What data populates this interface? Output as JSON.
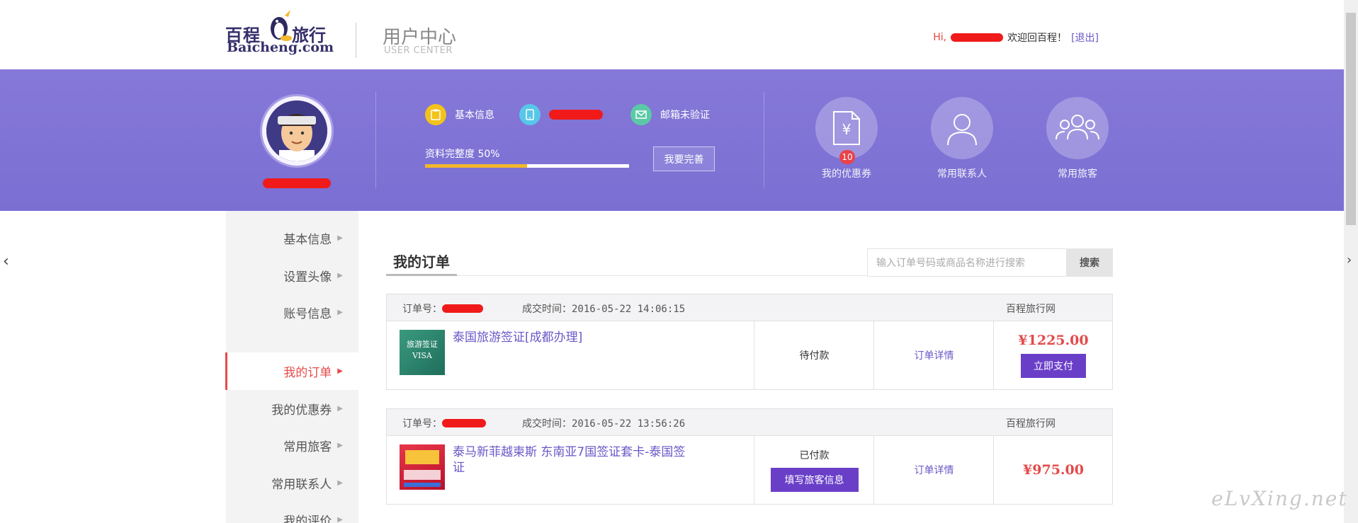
{
  "header": {
    "logo_cn_left": "百程",
    "logo_cn_right": "旅行",
    "logo_en": "Baicheng.com",
    "center_title": "用户中心",
    "center_subtitle": "USER CENTER",
    "greeting_hi": "Hi,",
    "greeting_welcome": "欢迎回百程！",
    "logout": "[退出]"
  },
  "profile": {
    "basic_info": "基本信息",
    "email_status": "邮箱未验证",
    "completion_label": "资料完整度 50%",
    "completion_value": 0.5,
    "complete_button": "我要完善"
  },
  "quick_links": [
    {
      "label": "我的优惠券",
      "badge": "10",
      "icon": "coupon-icon"
    },
    {
      "label": "常用联系人",
      "icon": "contact-icon"
    },
    {
      "label": "常用旅客",
      "icon": "travelers-icon"
    }
  ],
  "sidebar": {
    "items": [
      {
        "label": "基本信息"
      },
      {
        "label": "设置头像"
      },
      {
        "label": "账号信息"
      },
      {
        "label": "我的订单",
        "active": true
      },
      {
        "label": "我的优惠券"
      },
      {
        "label": "常用旅客"
      },
      {
        "label": "常用联系人"
      },
      {
        "label": "我的评价"
      }
    ]
  },
  "orders_section": {
    "title": "我的订单",
    "search_placeholder": "输入订单号码或商品名称进行搜索",
    "search_button": "搜索"
  },
  "orders": [
    {
      "order_no_label": "订单号：",
      "deal_time": "成交时间：2016-05-22 14:06:15",
      "shop": "百程旅行网",
      "thumb_text_1": "旅游签证",
      "thumb_text_2": "VISA",
      "product": "泰国旅游签证[成都办理]",
      "status": "待付款",
      "detail": "订单详情",
      "price": "¥1225.00",
      "action": "立即支付"
    },
    {
      "order_no_label": "订单号：",
      "deal_time": "成交时间：2016-05-22 13:56:26",
      "shop": "百程旅行网",
      "product": "泰马新菲越柬斯 东南亚7国签证套卡-泰国签证",
      "status": "已付款",
      "detail": "订单详情",
      "price": "¥975.00",
      "action": "填写旅客信息"
    }
  ],
  "watermark": "eLvXing.net",
  "colors": {
    "brand_purple": "#7b6fd3",
    "accent_red": "#e54a4a",
    "button_purple": "#6a3fc8",
    "progress_yellow": "#f3b82b"
  }
}
